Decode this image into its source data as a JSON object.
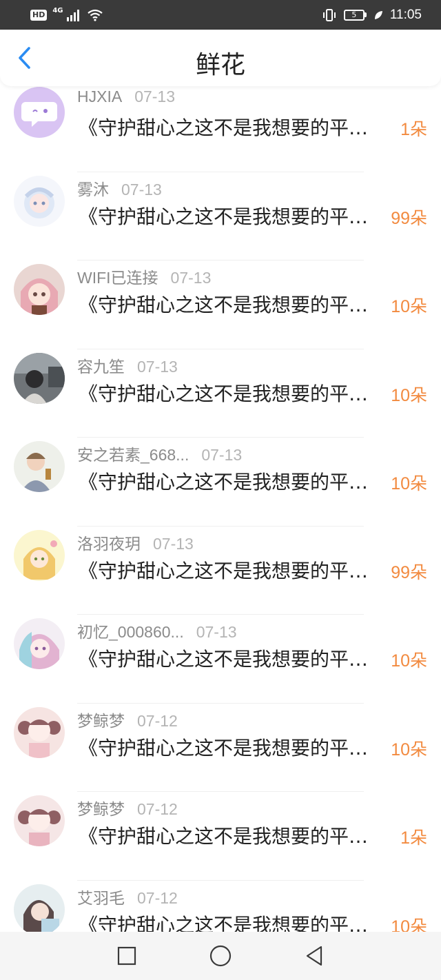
{
  "status_bar": {
    "hd": "HD",
    "network": "4G",
    "battery_level": "5",
    "time": "11:05"
  },
  "header": {
    "title": "鲜花",
    "back_icon": "chevron-left-icon",
    "accent_color": "#2a8cf2"
  },
  "count_color": "#f28a3f",
  "rows": [
    {
      "name": "HJXIA",
      "date": "07-13",
      "title": "《守护甜心之这不是我想要的平凡》",
      "count": "1朵",
      "avatar": "chat-bubble-avatar"
    },
    {
      "name": "雾沐",
      "date": "07-13",
      "title": "《守护甜心之这不是我想要的平凡》",
      "count": "99朵",
      "avatar": "anime-girl-avatar"
    },
    {
      "name": "WIFI已连接",
      "date": "07-13",
      "title": "《守护甜心之这不是我想要的平凡》",
      "count": "10朵",
      "avatar": "anime-girl-avatar"
    },
    {
      "name": "容九笙",
      "date": "07-13",
      "title": "《守护甜心之这不是我想要的平凡》",
      "count": "10朵",
      "avatar": "photo-avatar"
    },
    {
      "name": "安之若素_668...",
      "date": "07-13",
      "title": "《守护甜心之这不是我想要的平凡》",
      "count": "10朵",
      "avatar": "photo-avatar"
    },
    {
      "name": "洛羽夜玥",
      "date": "07-13",
      "title": "《守护甜心之这不是我想要的平凡》",
      "count": "99朵",
      "avatar": "anime-girl-avatar"
    },
    {
      "name": "初忆_000860...",
      "date": "07-13",
      "title": "《守护甜心之这不是我想要的平凡》",
      "count": "10朵",
      "avatar": "anime-girl-avatar"
    },
    {
      "name": "梦鲸梦",
      "date": "07-12",
      "title": "《守护甜心之这不是我想要的平凡》",
      "count": "10朵",
      "avatar": "anime-girl-avatar"
    },
    {
      "name": "梦鲸梦",
      "date": "07-12",
      "title": "《守护甜心之这不是我想要的平凡》",
      "count": "1朵",
      "avatar": "anime-girl-avatar"
    },
    {
      "name": "艾羽毛",
      "date": "07-12",
      "title": "《守护甜心之这不是我想要的平凡》",
      "count": "10朵",
      "avatar": "anime-girl-avatar"
    }
  ],
  "nav_bar": {
    "recent_icon": "square-icon",
    "home_icon": "circle-icon",
    "back_icon": "triangle-back-icon"
  }
}
